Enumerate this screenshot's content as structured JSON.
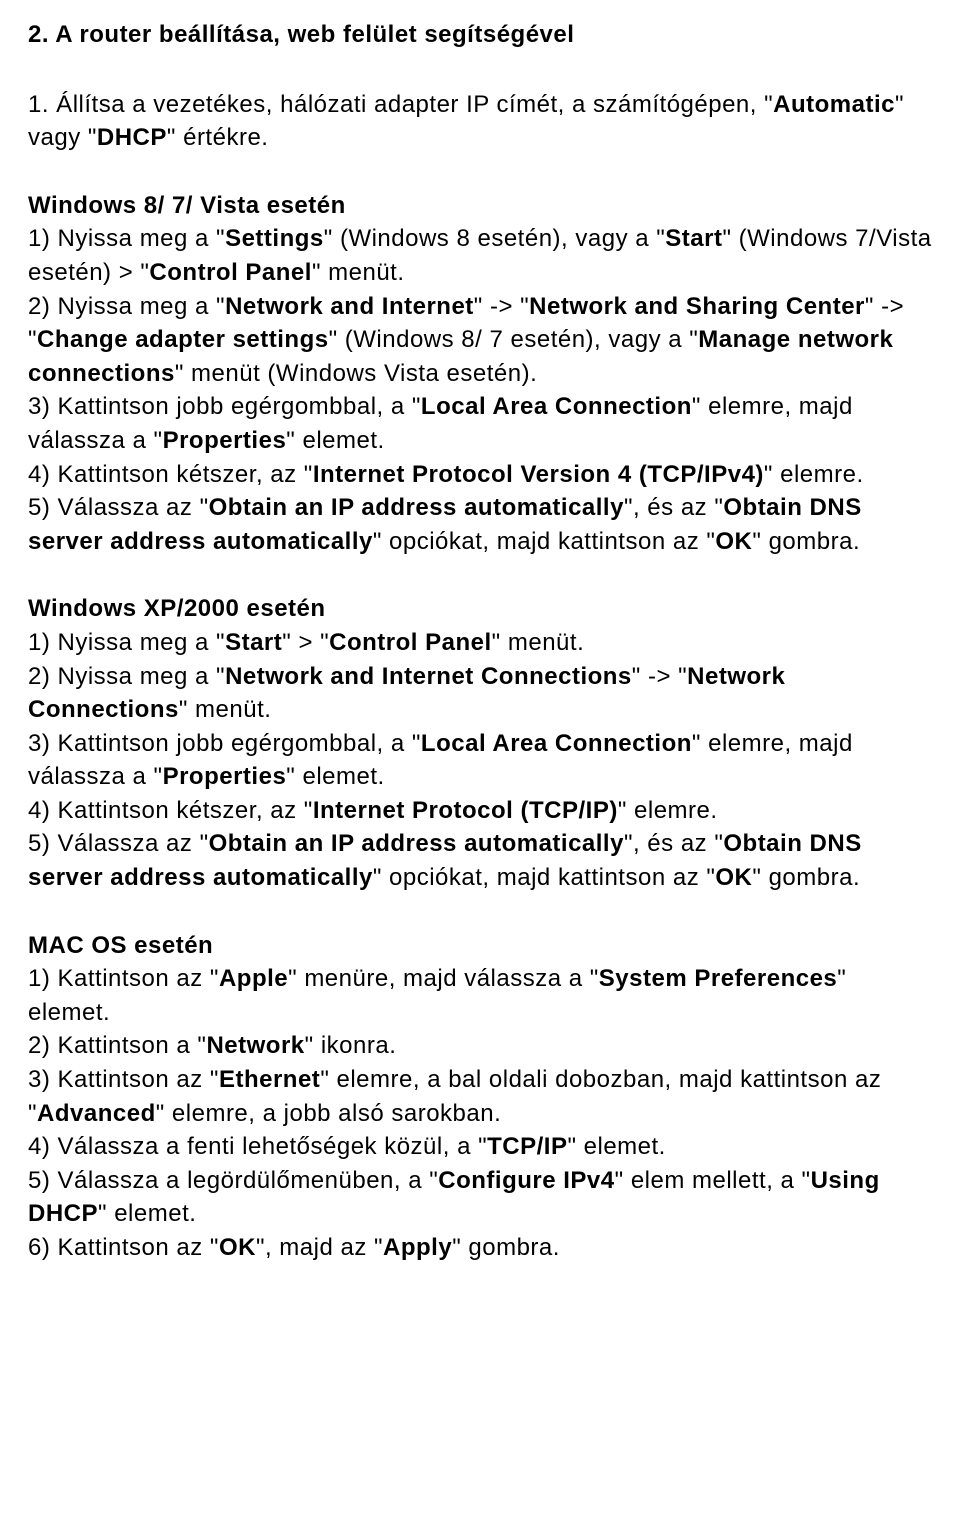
{
  "title": "2. A router beállítása, web felület segítségével",
  "intro": {
    "t1": "1. Állítsa a vezetékes, hálózati adapter IP címét, a számítógépen, \"",
    "b1": "Automatic",
    "t2": "\" vagy \"",
    "b2": "DHCP",
    "t3": "\" értékre."
  },
  "win87": {
    "heading": "Windows 8/ 7/ Vista esetén",
    "s1": {
      "t1": "1) Nyissa meg a \"",
      "b1": "Settings",
      "t2": "\" (Windows 8 esetén), vagy a \"",
      "b2": "Start",
      "t3": "\" (Windows 7/Vista esetén) > \"",
      "b3": "Control Panel",
      "t4": "\" menüt."
    },
    "s2": {
      "t1": "2) Nyissa meg a \"",
      "b1": "Network and Internet",
      "t2": "\" -> \"",
      "b2": "Network and Sharing Center",
      "t3": "\" -> \"",
      "b3": "Change adapter settings",
      "t4": "\" (Windows 8/ 7 esetén), vagy a \"",
      "b4": "Manage network connections",
      "t5": "\" menüt (Windows Vista esetén)."
    },
    "s3": {
      "t1": "3) Kattintson jobb egérgombbal, a \"",
      "b1": "Local Area Connection",
      "t2": "\" elemre, majd válassza a \"",
      "b2": "Properties",
      "t3": "\" elemet."
    },
    "s4": {
      "t1": "4) Kattintson kétszer, az \"",
      "b1": "Internet Protocol Version 4 (TCP/IPv4)",
      "t2": "\" elemre."
    },
    "s5": {
      "t1": "5) Válassza az \"",
      "b1": "Obtain an IP address automatically",
      "t2": "\", és az \"",
      "b2": "Obtain DNS server address automatically",
      "t3": "\" opciókat, majd kattintson az \"",
      "b3": "OK",
      "t4": "\" gombra."
    }
  },
  "winxp": {
    "heading": "Windows XP/2000 esetén",
    "s1": {
      "t1": "1) Nyissa meg a \"",
      "b1": "Start",
      "t2": "\" > \"",
      "b2": "Control Panel",
      "t3": "\" menüt."
    },
    "s2": {
      "t1": "2) Nyissa meg a \"",
      "b1": "Network and Internet Connections",
      "t2": "\" -> \"",
      "b2": "Network Connections",
      "t3": "\" menüt."
    },
    "s3": {
      "t1": "3) Kattintson jobb egérgombbal, a \"",
      "b1": "Local Area Connection",
      "t2": "\" elemre, majd válassza a \"",
      "b2": "Properties",
      "t3": "\" elemet."
    },
    "s4": {
      "t1": "4) Kattintson kétszer, az \"",
      "b1": "Internet Protocol (TCP/IP)",
      "t2": "\" elemre."
    },
    "s5": {
      "t1": "5) Válassza az \"",
      "b1": "Obtain an IP address automatically",
      "t2": "\", és az \"",
      "b2": "Obtain DNS server address automatically",
      "t3": "\" opciókat, majd kattintson az \"",
      "b3": "OK",
      "t4": "\" gombra."
    }
  },
  "mac": {
    "heading": "MAC OS esetén",
    "s1": {
      "t1": "1) Kattintson az  \"",
      "b1": "Apple",
      "t2": "\" menüre, majd válassza a \"",
      "b2": "System Preferences",
      "t3": "\" elemet."
    },
    "s2": {
      "t1": "2) Kattintson a  \"",
      "b1": "Network",
      "t2": "\" ikonra."
    },
    "s3": {
      "t1": "3) Kattintson az \"",
      "b1": "Ethernet",
      "t2": "\" elemre, a bal oldali dobozban, majd kattintson az \"",
      "b2": "Advanced",
      "t3": "\" elemre, a jobb alsó sarokban."
    },
    "s4": {
      "t1": "4) Válassza a fenti lehetőségek közül, a \"",
      "b1": "TCP/IP",
      "t2": "\" elemet."
    },
    "s5": {
      "t1": "5) Válassza a legördülőmenüben, a \"",
      "b1": "Configure IPv4",
      "t2": "\" elem mellett, a \"",
      "b2": "Using DHCP",
      "t3": "\" elemet."
    },
    "s6": {
      "t1": "6) Kattintson az \"",
      "b1": "OK",
      "t2": "\", majd az \"",
      "b2": "Apply",
      "t3": "\" gombra."
    }
  }
}
